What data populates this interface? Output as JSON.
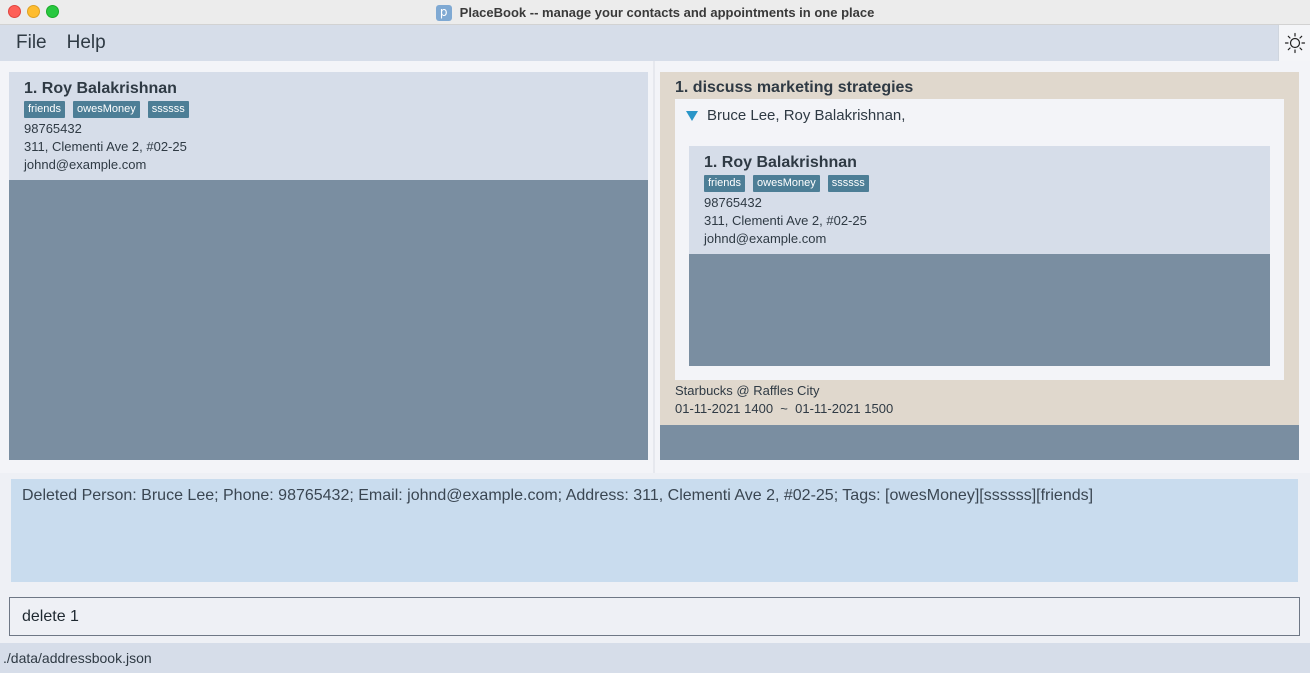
{
  "window": {
    "title": "PlaceBook -- manage your contacts and appointments in one place",
    "app_icon_glyph": "p"
  },
  "menu": {
    "items": [
      "File",
      "Help"
    ]
  },
  "theme_toggle": {
    "icon": "sun-icon"
  },
  "person_list": {
    "cards": [
      {
        "index_name": "1.  Roy Balakrishnan",
        "tags": [
          "friends",
          "owesMoney",
          "ssssss"
        ],
        "phone": "98765432",
        "address": "311, Clementi Ave 2, #02-25",
        "email": "johnd@example.com"
      }
    ]
  },
  "appointment_list": {
    "cards": [
      {
        "index_description": "1.  discuss marketing strategies",
        "clients_summary": "Bruce Lee, Roy Balakrishnan,",
        "clients": [
          {
            "index_name": "1.  Roy Balakrishnan",
            "tags": [
              "friends",
              "owesMoney",
              "ssssss"
            ],
            "phone": "98765432",
            "address": "311, Clementi Ave 2, #02-25",
            "email": "johnd@example.com"
          }
        ],
        "location": "Starbucks @ Raffles City",
        "time_range": "01-11-2021 1400  ~  01-11-2021 1500"
      }
    ]
  },
  "result_display": {
    "text": "Deleted Person: Bruce Lee; Phone: 98765432; Email: johnd@example.com; Address: 311, Clementi Ave 2, #02-25; Tags: [owesMoney][ssssss][friends]"
  },
  "command_box": {
    "value": "delete 1"
  },
  "status_bar": {
    "path": "./data/addressbook.json"
  },
  "colors": {
    "accent": "#4d7e96",
    "panel": "#7a8ea1",
    "card": "#d6dde9",
    "appointment_card": "#e0d8cd",
    "result": "#c9dcee"
  }
}
